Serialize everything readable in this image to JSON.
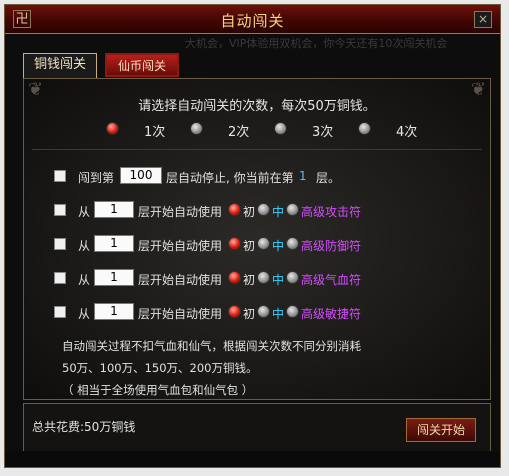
{
  "window": {
    "title": "自动闯关",
    "logo_glyph": "卍",
    "close_label": "×",
    "ticker_text": "大机会，VIP体验用双机会，你今天还有10次闯关机会"
  },
  "tabs": [
    {
      "label": "铜钱闯关",
      "active": true
    },
    {
      "label": "仙币闯关",
      "active": false
    }
  ],
  "prompt": "请选择自动闯关的次数，每次50万铜钱。",
  "count_options": [
    {
      "label": "1次",
      "selected": true
    },
    {
      "label": "2次",
      "selected": false
    },
    {
      "label": "3次",
      "selected": false
    },
    {
      "label": "4次",
      "selected": false
    }
  ],
  "stop_row": {
    "prefix": "闯到第",
    "value": "100",
    "middle": "层自动停止, 你当前在第",
    "current": "1",
    "suffix": "层。"
  },
  "item_rows": [
    {
      "from": "从",
      "value": "1",
      "text": "层开始自动使用",
      "low": "初",
      "mid": "中",
      "high": "高级攻击符"
    },
    {
      "from": "从",
      "value": "1",
      "text": "层开始自动使用",
      "low": "初",
      "mid": "中",
      "high": "高级防御符"
    },
    {
      "from": "从",
      "value": "1",
      "text": "层开始自动使用",
      "low": "初",
      "mid": "中",
      "high": "高级气血符"
    },
    {
      "from": "从",
      "value": "1",
      "text": "层开始自动使用",
      "low": "初",
      "mid": "中",
      "high": "高级敏捷符"
    }
  ],
  "notes": [
    "自动闯关过程不扣气血和仙气，根据闯关次数不同分别消耗",
    "50万、100万、150万、200万铜钱。",
    "（ 相当于全场使用气血包和仙气包 ）"
  ],
  "footer": {
    "total": "总共花费:50万铜钱",
    "start_button": "闯关开始"
  },
  "colors": {
    "title_gold": "#f3d680",
    "level_mid": "#3ad2ff",
    "level_high": "#d44cff",
    "selected_radio": "#e01a10"
  }
}
